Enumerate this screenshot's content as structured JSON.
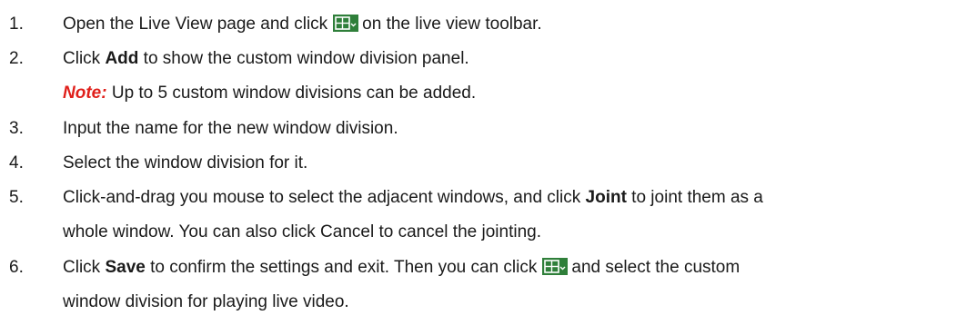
{
  "steps": [
    {
      "num": "1.",
      "pre": "Open the Live View page and click",
      "icon": "window-division-icon",
      "post": "on the live view toolbar."
    },
    {
      "num": "2.",
      "pre": "Click ",
      "bold": "Add",
      "post": " to show the custom window division panel.",
      "note_label": "Note:",
      "note_text": " Up to 5 custom window divisions can be added."
    },
    {
      "num": "3.",
      "text": "Input the name for the new window division."
    },
    {
      "num": "4.",
      "text": "Select the window division for it."
    },
    {
      "num": "5.",
      "pre": "Click-and-drag you mouse to select the adjacent windows, and click ",
      "bold": "Joint",
      "post": " to joint them as a",
      "line2": "whole window. You can also click Cancel to cancel the jointing."
    },
    {
      "num": "6.",
      "pre": "Click ",
      "bold": "Save",
      "post": " to confirm the settings and exit. Then you can click",
      "icon": "window-division-icon",
      "post2": "and select the custom",
      "line2": "window division for playing live video."
    }
  ],
  "colors": {
    "note": "#e0201b",
    "icon_bg": "#2f7f3a",
    "text": "#1a1a1a"
  }
}
